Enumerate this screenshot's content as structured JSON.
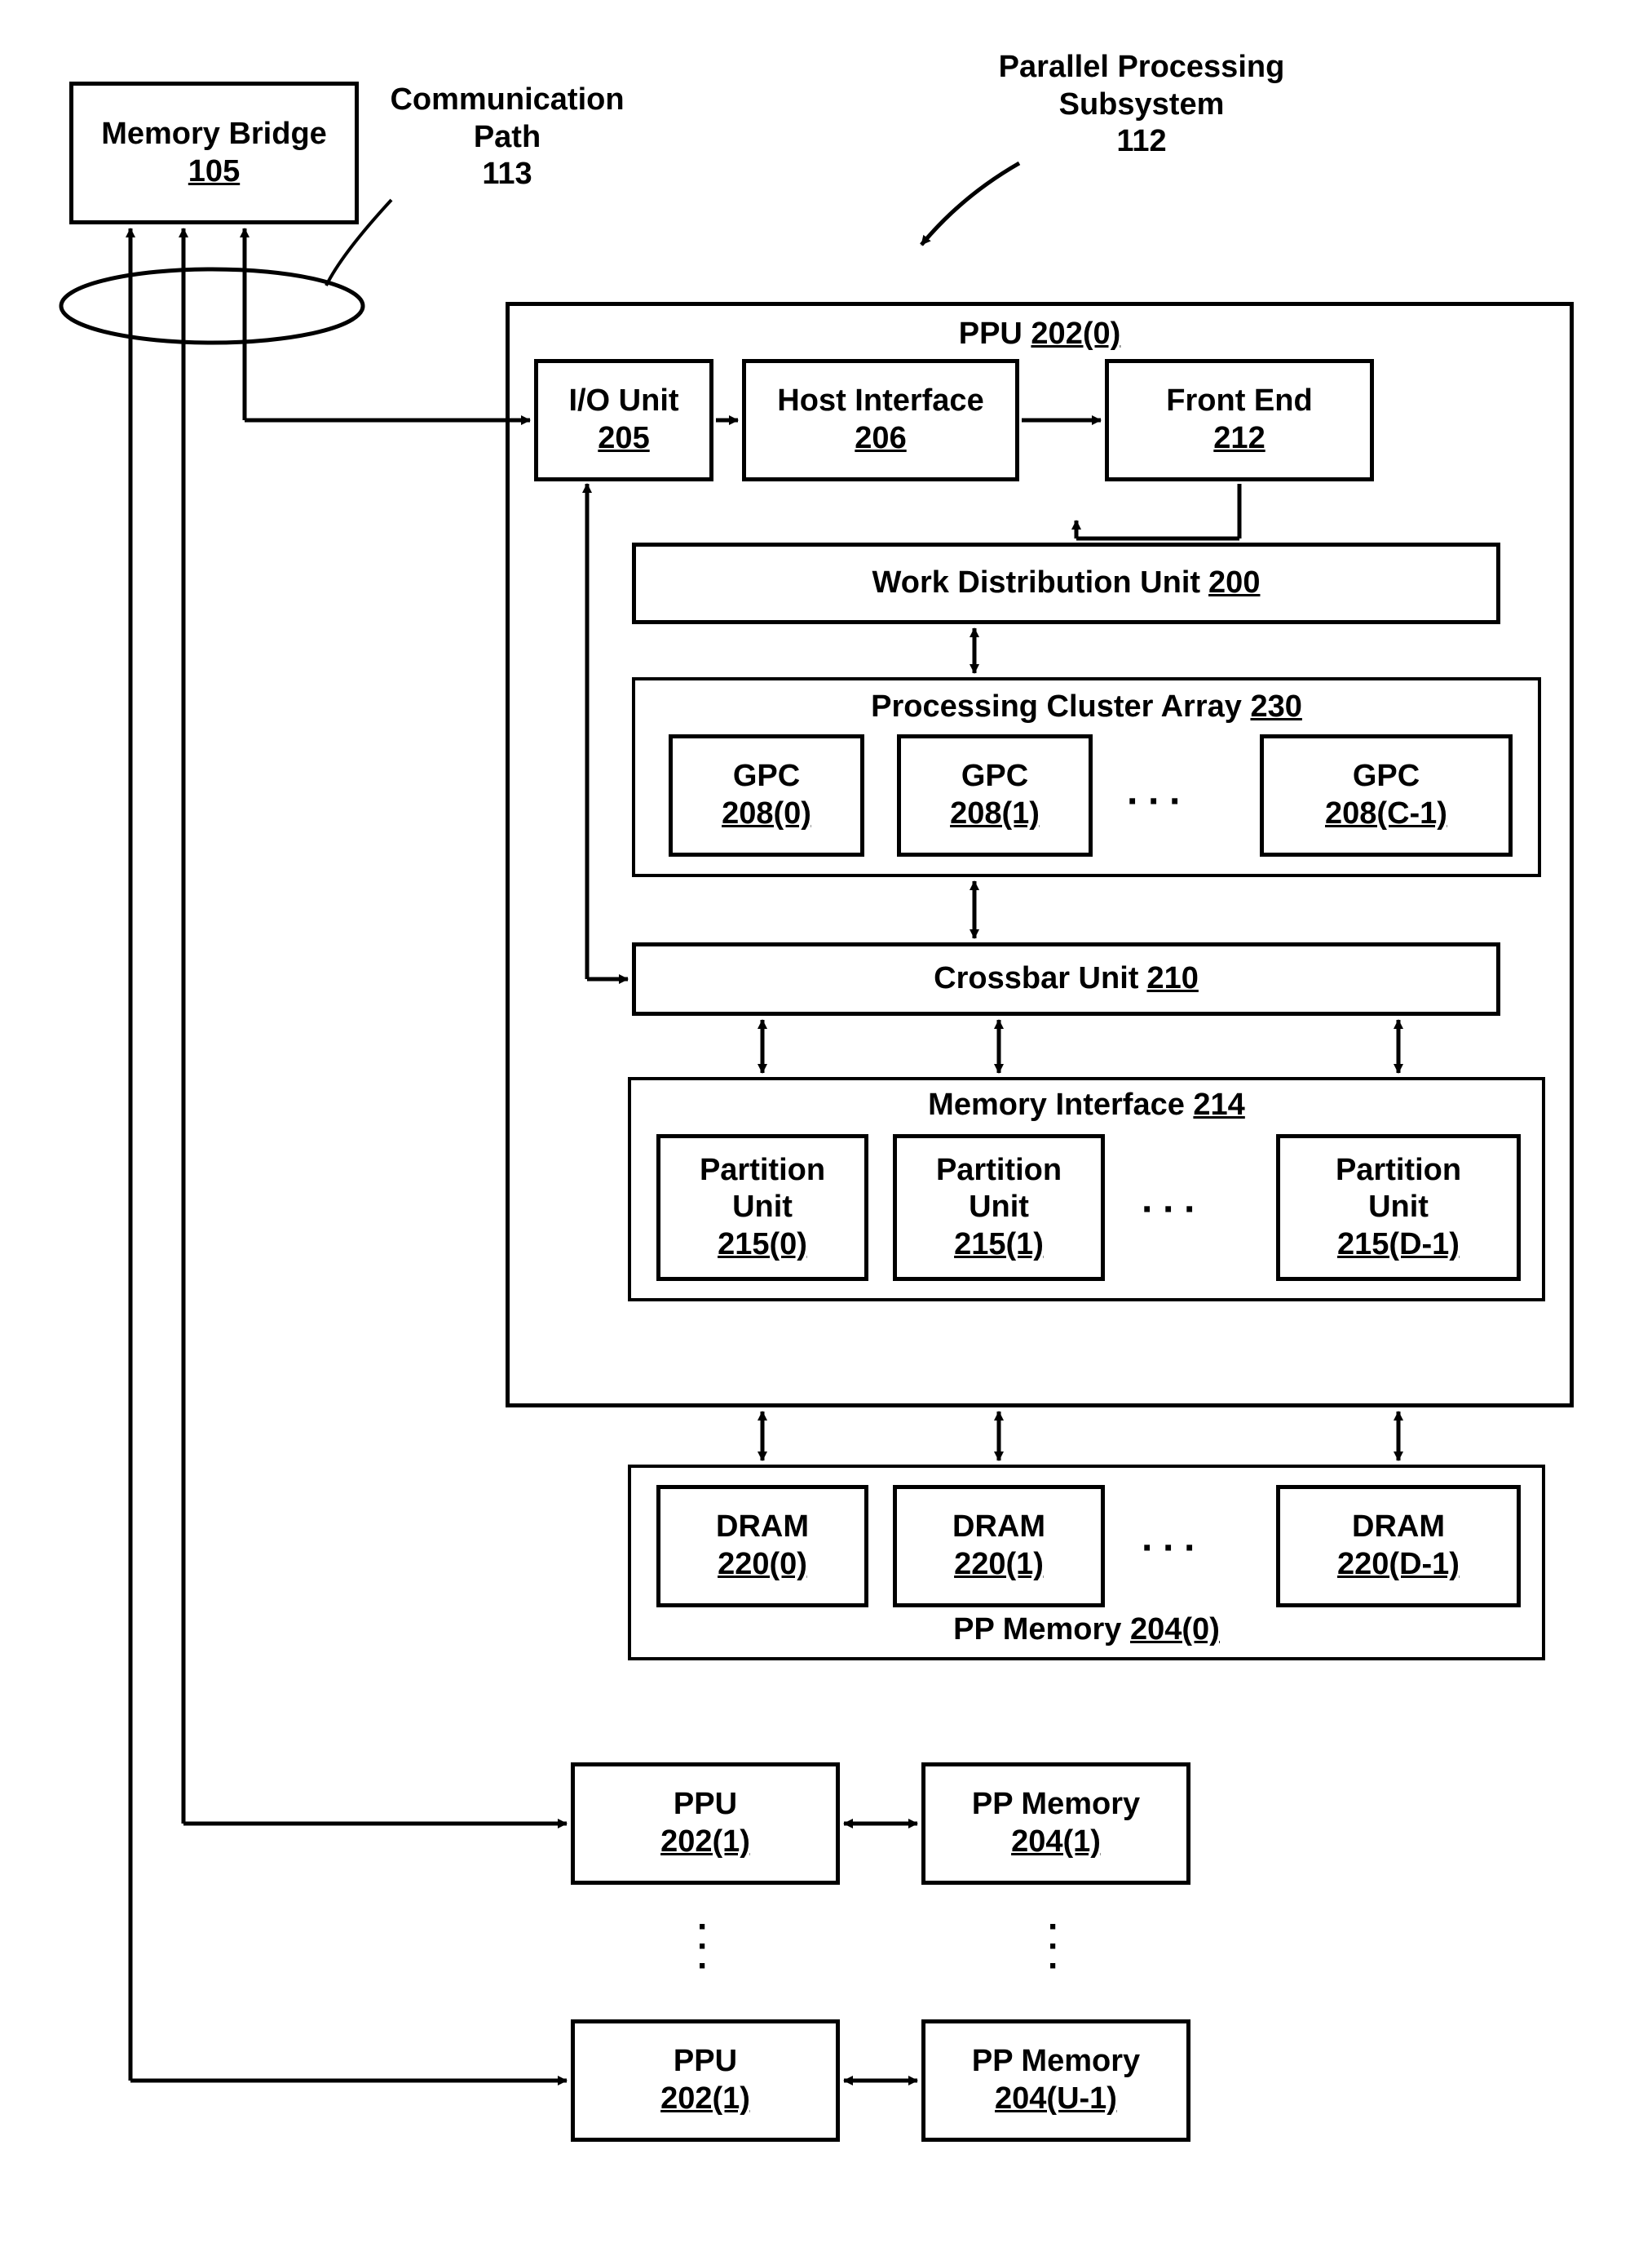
{
  "memoryBridge": {
    "title": "Memory Bridge",
    "ref": "105"
  },
  "commPath": {
    "title": "Communication",
    "sub": "Path",
    "ref": "113"
  },
  "subsystem": {
    "title": "Parallel Processing",
    "sub": "Subsystem",
    "ref": "112"
  },
  "ppu0": {
    "title": "PPU",
    "ref": "202(0)"
  },
  "io": {
    "title": "I/O Unit",
    "ref": "205"
  },
  "host": {
    "title": "Host Interface",
    "ref": "206"
  },
  "frontEnd": {
    "title": "Front End",
    "ref": "212"
  },
  "wdu": {
    "title": "Work Distribution Unit",
    "ref": "200"
  },
  "pca": {
    "title": "Processing Cluster Array",
    "ref": "230"
  },
  "gpc0": {
    "title": "GPC",
    "ref": "208(0)"
  },
  "gpc1": {
    "title": "GPC",
    "ref": "208(1)"
  },
  "gpcC": {
    "title": "GPC",
    "ref": "208(C-1)"
  },
  "crossbar": {
    "title": "Crossbar Unit",
    "ref": "210"
  },
  "memIf": {
    "title": "Memory Interface",
    "ref": "214"
  },
  "pu0": {
    "title": "Partition",
    "sub": "Unit",
    "ref": "215(0)"
  },
  "pu1": {
    "title": "Partition",
    "sub": "Unit",
    "ref": "215(1)"
  },
  "puD": {
    "title": "Partition",
    "sub": "Unit",
    "ref": "215(D-1)"
  },
  "dram0": {
    "title": "DRAM",
    "ref": "220(0)"
  },
  "dram1": {
    "title": "DRAM",
    "ref": "220(1)"
  },
  "dramD": {
    "title": "DRAM",
    "ref": "220(D-1)"
  },
  "ppMem0": {
    "title": "PP Memory",
    "ref": "204(0)"
  },
  "ppu1": {
    "title": "PPU",
    "ref": "202(1)"
  },
  "ppMem1": {
    "title": "PP Memory",
    "ref": "204(1)"
  },
  "ppuU": {
    "title": "PPU",
    "ref": "202(1)"
  },
  "ppMemU": {
    "title": "PP Memory",
    "ref": "204(U-1)"
  }
}
